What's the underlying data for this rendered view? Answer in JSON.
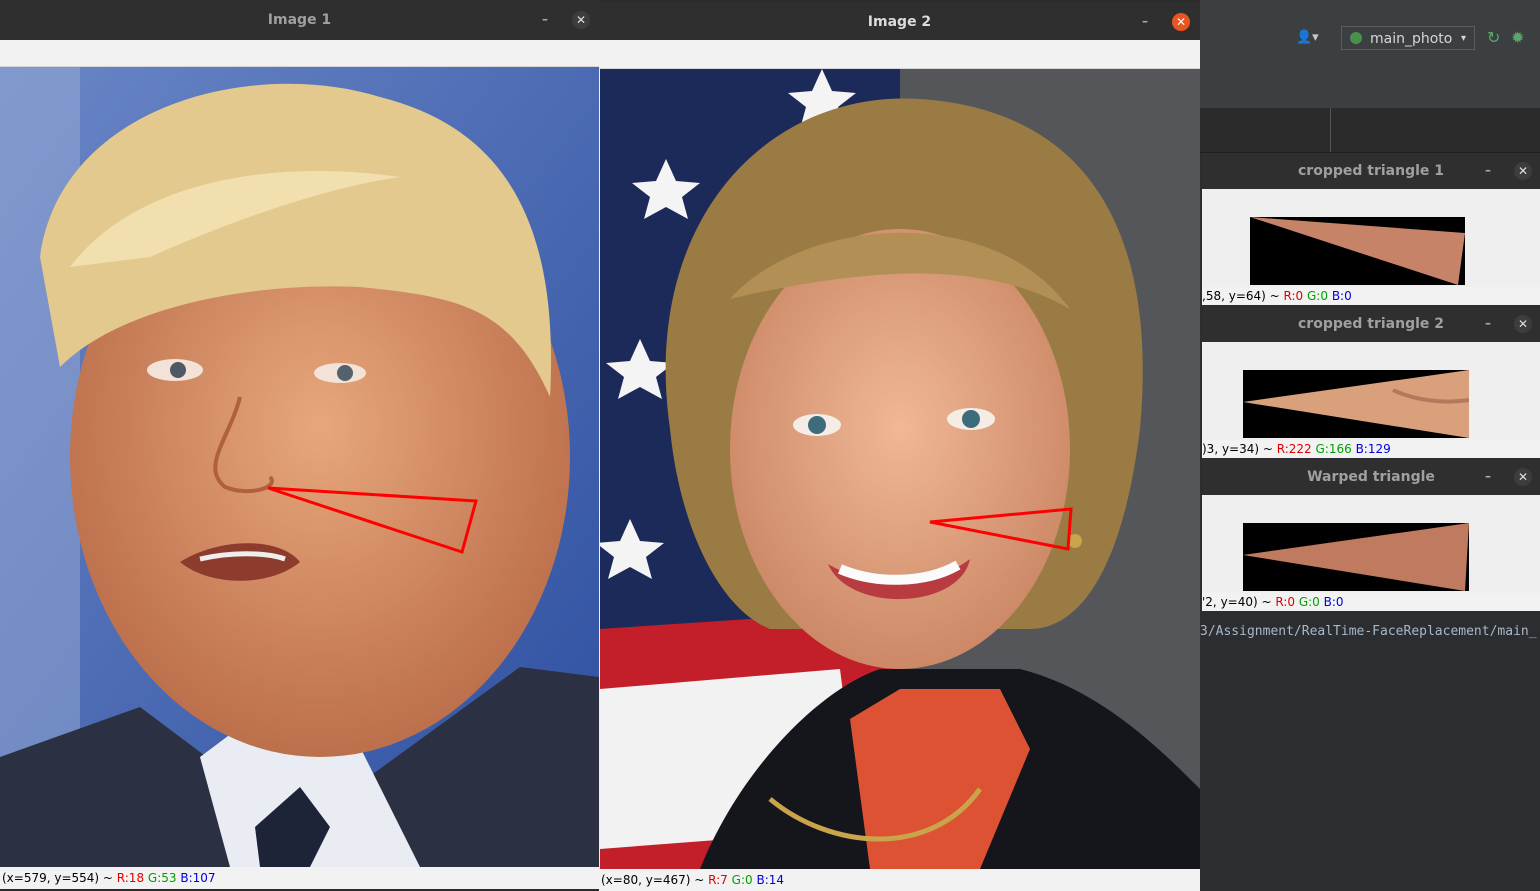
{
  "ide": {
    "run_config": "main_photo",
    "console_path": "3/Assignment/RealTime-FaceReplacement/main_"
  },
  "image1": {
    "title": "Image 1",
    "status": {
      "coords": "(x=579, y=554) ~ ",
      "r": "R:18",
      "g": "G:53",
      "b": "B:107"
    }
  },
  "image2": {
    "title": "Image 2",
    "status": {
      "coords": "(x=80, y=467) ~ ",
      "r": "R:7",
      "g": "G:0",
      "b": "B:14"
    }
  },
  "cropped1": {
    "title": "cropped triangle 1",
    "status": {
      "coords": ",58, y=64) ~ ",
      "r": "R:0",
      "g": "G:0",
      "b": "B:0"
    }
  },
  "cropped2": {
    "title": "cropped triangle 2",
    "status": {
      "coords": ")3, y=34) ~ ",
      "r": "R:222",
      "g": "G:166",
      "b": "B:129"
    }
  },
  "warped": {
    "title": "Warped triangle",
    "status": {
      "coords": "'2, y=40) ~ ",
      "r": "R:0",
      "g": "G:0",
      "b": "B:0"
    }
  },
  "glyphs": {
    "minimize": "–",
    "close": "✕",
    "caret": "▾",
    "user": "👤▾",
    "rerun": "↻",
    "debug": "✹"
  },
  "colors": {
    "triangle_stroke": "#ff0000",
    "close_active": "#e95420"
  }
}
